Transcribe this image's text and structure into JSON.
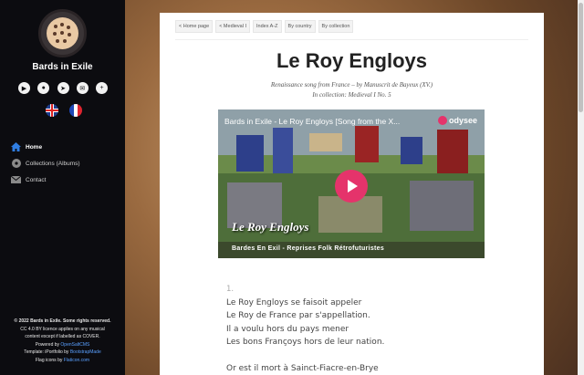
{
  "sidebar": {
    "site_title": "Bards in Exile",
    "socials": [
      {
        "icon": "youtube-icon",
        "glyph": "▶"
      },
      {
        "icon": "odysee-icon",
        "glyph": "●"
      },
      {
        "icon": "telegram-icon",
        "glyph": "➤"
      },
      {
        "icon": "messenger-icon",
        "glyph": "✉"
      },
      {
        "icon": "plus-icon",
        "glyph": "+"
      }
    ],
    "languages": [
      "english-flag",
      "french-flag"
    ],
    "nav": [
      {
        "label": "Home",
        "icon": "home-icon",
        "active": true
      },
      {
        "label": "Collections (Albums)",
        "icon": "disc-icon",
        "active": false
      },
      {
        "label": "Contact",
        "icon": "envelope-icon",
        "active": false
      }
    ],
    "footer": {
      "copyright": "© 2022 Bards in Exile. Some rights reserved.",
      "license_1": "CC 4.0 BY licence applies on any musical",
      "license_2": "content except if labelled as COVER.",
      "powered_prefix": "Powered by",
      "powered_link": "OpenSaltCMS",
      "template_prefix": "Template: iPortfolio by",
      "template_link": "BootstrapMade",
      "flags_prefix": "Flag icons by",
      "flags_link": "Flaticon.com"
    }
  },
  "crumbs": [
    "< Home page",
    "< Medieval I",
    "Index A-Z",
    "By country",
    "By collection"
  ],
  "page": {
    "title": "Le Roy Engloys",
    "subtitle": "Renaissance song from France – by Manuscrit de Bayeux (XV.)",
    "collection": "In collection: Medieval I No. 5"
  },
  "video": {
    "title": "Bards in Exile - Le Roy Engloys [Song from the X...",
    "brand": "odysee",
    "overlay_text": "Le Roy Engloys",
    "caption": "Bardes En Exil - Reprises Folk Rétrofuturistes"
  },
  "lyrics": {
    "verse_number": "1.",
    "lines": [
      "Le Roy Engloys se faisoit appeler",
      "Le Roy de France par s'appellation.",
      "Il a voulu hors du pays mener",
      "Les bons Françoys hors de leur nation."
    ],
    "next_line": "Or est il mort à Sainct-Fiacre-en-Brye"
  },
  "colors": {
    "sidebar_bg": "#0c0c10",
    "accent_link": "#5aa0ff",
    "odysee_pink": "#e5336b"
  }
}
